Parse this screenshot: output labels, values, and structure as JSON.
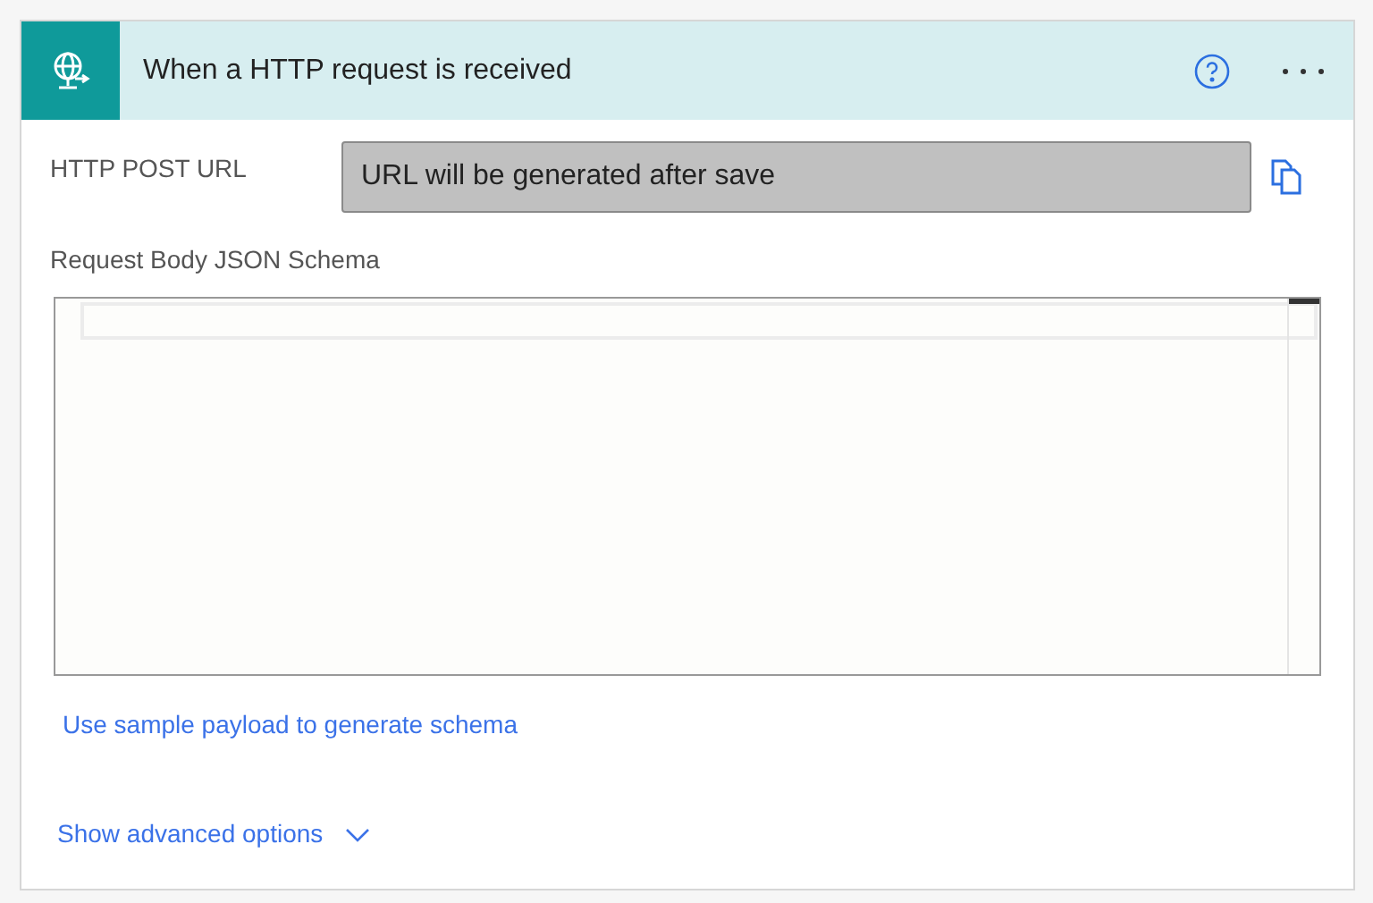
{
  "card": {
    "title": "When a HTTP request is received"
  },
  "url_field": {
    "label": "HTTP POST URL",
    "value": "URL will be generated after save"
  },
  "schema": {
    "label": "Request Body JSON Schema"
  },
  "sample_link": "Use sample payload to generate schema",
  "advanced": {
    "label": "Show advanced options",
    "expanded": false
  }
}
